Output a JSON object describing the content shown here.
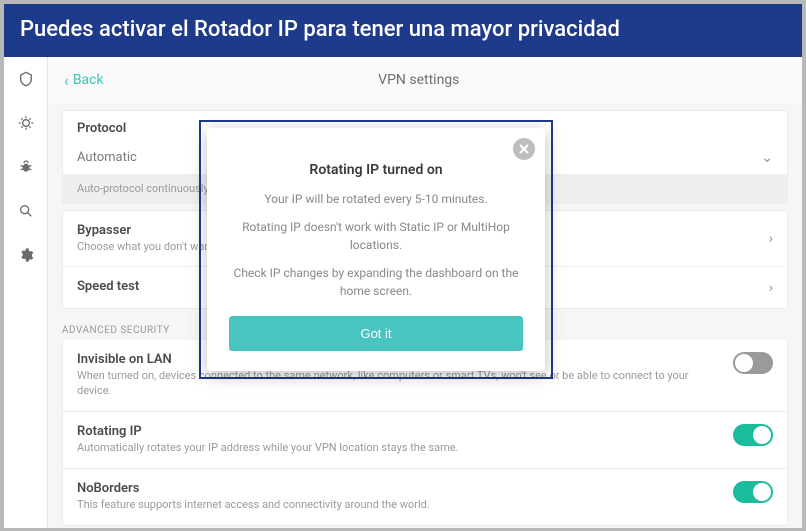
{
  "banner": "Puedes activar el Rotador IP para tener una mayor privacidad",
  "header": {
    "back": "Back",
    "title": "VPN settings"
  },
  "sidebar_icons": [
    "shield",
    "bug",
    "bug2",
    "search",
    "gear"
  ],
  "protocol": {
    "title": "Protocol",
    "value": "Automatic",
    "description": "Auto-protocol continuously chooses the best protocol/port configuration for you."
  },
  "items": [
    {
      "title": "Bypasser",
      "desc": "Choose what you don't want to run through the VPN."
    },
    {
      "title": "Speed test",
      "desc": ""
    }
  ],
  "advanced": {
    "header": "ADVANCED SECURITY",
    "rows": [
      {
        "title": "Invisible on LAN",
        "desc": "When turned on, devices connected to the same network, like computers or smart TVs, won't see or be able to connect to your device.",
        "on": false
      },
      {
        "title": "Rotating IP",
        "desc": "Automatically rotates your IP address while your VPN location stays the same.",
        "on": true
      },
      {
        "title": "NoBorders",
        "desc": "This feature supports internet access and connectivity around the world.",
        "on": true
      }
    ]
  },
  "modal": {
    "title": "Rotating IP turned on",
    "line1": "Your IP will be rotated every 5-10 minutes.",
    "line2": "Rotating IP doesn't work with Static IP or MultiHop locations.",
    "line3": "Check IP changes by expanding the dashboard on the home screen.",
    "button": "Got it"
  }
}
